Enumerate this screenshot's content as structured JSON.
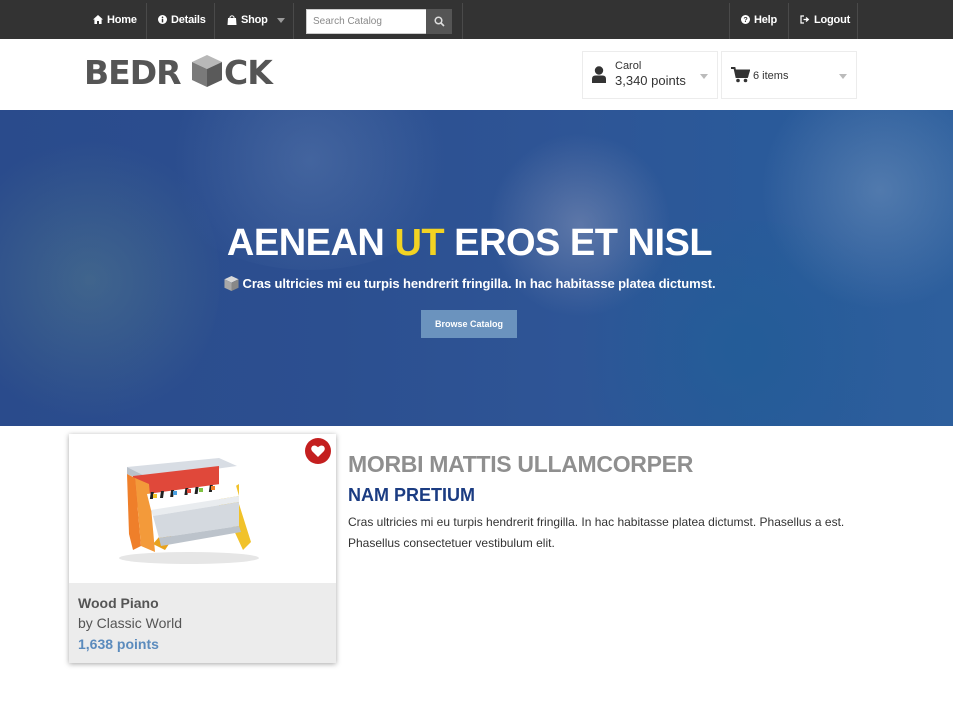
{
  "topnav": {
    "home": "Home",
    "details": "Details",
    "shop": "Shop",
    "search_placeholder": "Search Catalog",
    "help": "Help",
    "logout": "Logout"
  },
  "header": {
    "logo_text": "BEDROCK",
    "user_name": "Carol",
    "user_points": "3,340 points",
    "cart_count": "6 items"
  },
  "hero": {
    "title_part1": "AENEAN ",
    "title_highlight": "UT",
    "title_part2": " EROS ET NISL",
    "subtitle": "Cras ultricies mi eu turpis hendrerit fringilla. In hac habitasse platea dictumst.",
    "button": "Browse Catalog"
  },
  "product": {
    "name": "Wood Piano",
    "brand": "by Classic World",
    "points": "1,638 points"
  },
  "section": {
    "title": "MORBI MATTIS ULLAMCORPER",
    "subtitle": "NAM PRETIUM",
    "body": "Cras ultricies mi eu turpis hendrerit fringilla. In hac habitasse platea dictumst. Phasellus a est. Phasellus consectetuer vestibulum elit."
  },
  "colors": {
    "nav_bg": "#333333",
    "hero_blue": "#2c4f90",
    "highlight_yellow": "#f2d323",
    "button_blue": "#6b93be",
    "points_blue": "#5b8bbd",
    "subtitle_navy": "#1b3c82",
    "favorite_red": "#c41f1f"
  },
  "icons": [
    "home-icon",
    "info-icon",
    "shopping-bag-icon",
    "search-icon",
    "help-icon",
    "logout-icon",
    "user-icon",
    "cart-icon",
    "cube-icon",
    "heart-icon"
  ]
}
